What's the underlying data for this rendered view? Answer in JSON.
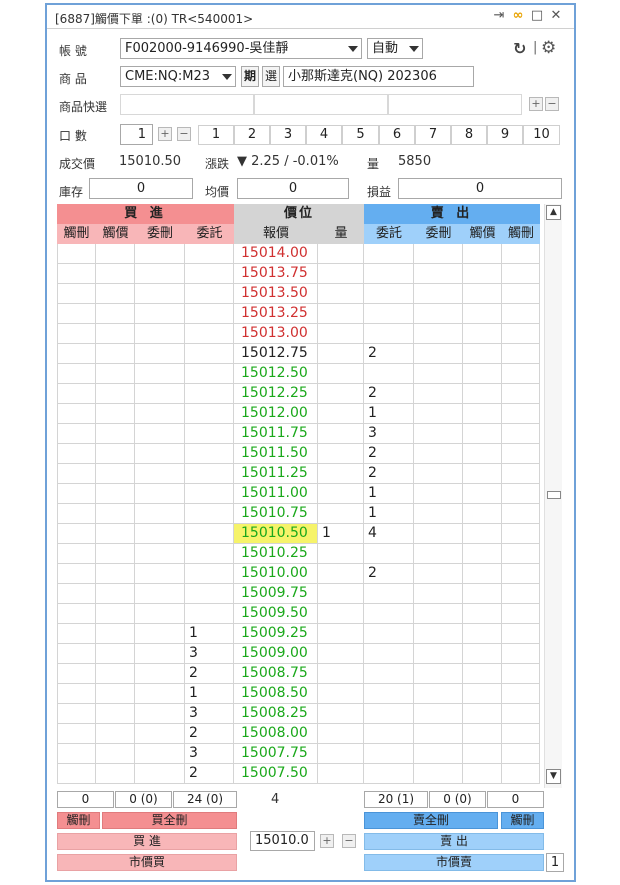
{
  "window": {
    "title": "[6887]觸價下單 :(0) TR<540001>",
    "title_icons": [
      "exit-icon",
      "link-icon",
      "maximize-icon",
      "close-icon"
    ]
  },
  "account": {
    "label": "帳 號",
    "value": "F002000-9146990-吳佳靜",
    "mode": "自動"
  },
  "product": {
    "label": "商 品",
    "code": "CME:NQ:M23",
    "period_button": "期",
    "select_button": "選",
    "name": "小那斯達克(NQ) 202306"
  },
  "quick_select": {
    "label": "商品快選",
    "slots": [
      "",
      "",
      ""
    ]
  },
  "quantity": {
    "label": "口 數",
    "value": "1",
    "presets": [
      "1",
      "2",
      "3",
      "4",
      "5",
      "6",
      "7",
      "8",
      "9",
      "10"
    ]
  },
  "quote": {
    "last_label": "成交價",
    "last_value": "15010.50",
    "change_label": "漲跌",
    "change_value": "▼ 2.25 / -0.01%",
    "volume_label": "量",
    "volume_value": "5850"
  },
  "position": {
    "inventory_label": "庫存",
    "inventory_value": "0",
    "avg_label": "均價",
    "avg_value": "0",
    "pnl_label": "損益",
    "pnl_value": "0"
  },
  "ladder": {
    "buy_header": "買 進",
    "price_header": "價位",
    "sell_header": "賣 出",
    "subheaders": [
      "觸刪",
      "觸價",
      "委刪",
      "委託",
      "報價",
      "量",
      "委託",
      "委刪",
      "觸價",
      "觸刪"
    ],
    "rows": [
      {
        "price": "15014.00",
        "color": "red",
        "buy": "",
        "vol": "",
        "sell": ""
      },
      {
        "price": "15013.75",
        "color": "red",
        "buy": "",
        "vol": "",
        "sell": ""
      },
      {
        "price": "15013.50",
        "color": "red",
        "buy": "",
        "vol": "",
        "sell": ""
      },
      {
        "price": "15013.25",
        "color": "red",
        "buy": "",
        "vol": "",
        "sell": ""
      },
      {
        "price": "15013.00",
        "color": "red",
        "buy": "",
        "vol": "",
        "sell": ""
      },
      {
        "price": "15012.75",
        "color": "black",
        "buy": "",
        "vol": "",
        "sell": "2"
      },
      {
        "price": "15012.50",
        "color": "green",
        "buy": "",
        "vol": "",
        "sell": ""
      },
      {
        "price": "15012.25",
        "color": "green",
        "buy": "",
        "vol": "",
        "sell": "2"
      },
      {
        "price": "15012.00",
        "color": "green",
        "buy": "",
        "vol": "",
        "sell": "1"
      },
      {
        "price": "15011.75",
        "color": "green",
        "buy": "",
        "vol": "",
        "sell": "3"
      },
      {
        "price": "15011.50",
        "color": "green",
        "buy": "",
        "vol": "",
        "sell": "2"
      },
      {
        "price": "15011.25",
        "color": "green",
        "buy": "",
        "vol": "",
        "sell": "2"
      },
      {
        "price": "15011.00",
        "color": "green",
        "buy": "",
        "vol": "",
        "sell": "1"
      },
      {
        "price": "15010.75",
        "color": "green",
        "buy": "",
        "vol": "",
        "sell": "1"
      },
      {
        "price": "15010.50",
        "color": "green",
        "buy": "",
        "vol": "1",
        "sell": "4",
        "highlight": true
      },
      {
        "price": "15010.25",
        "color": "green",
        "buy": "",
        "vol": "",
        "sell": ""
      },
      {
        "price": "15010.00",
        "color": "green",
        "buy": "",
        "vol": "",
        "sell": "2"
      },
      {
        "price": "15009.75",
        "color": "green",
        "buy": "",
        "vol": "",
        "sell": ""
      },
      {
        "price": "15009.50",
        "color": "green",
        "buy": "",
        "vol": "",
        "sell": ""
      },
      {
        "price": "15009.25",
        "color": "green",
        "buy": "1",
        "vol": "",
        "sell": ""
      },
      {
        "price": "15009.00",
        "color": "green",
        "buy": "3",
        "vol": "",
        "sell": ""
      },
      {
        "price": "15008.75",
        "color": "green",
        "buy": "2",
        "vol": "",
        "sell": ""
      },
      {
        "price": "15008.50",
        "color": "green",
        "buy": "1",
        "vol": "",
        "sell": ""
      },
      {
        "price": "15008.25",
        "color": "green",
        "buy": "3",
        "vol": "",
        "sell": ""
      },
      {
        "price": "15008.00",
        "color": "green",
        "buy": "2",
        "vol": "",
        "sell": ""
      },
      {
        "price": "15007.75",
        "color": "green",
        "buy": "3",
        "vol": "",
        "sell": ""
      },
      {
        "price": "15007.50",
        "color": "green",
        "buy": "2",
        "vol": "",
        "sell": ""
      }
    ]
  },
  "footer": {
    "buy_totals": [
      "0",
      "0 (0)",
      "24 (0)"
    ],
    "center_count": "4",
    "sell_totals": [
      "20 (1)",
      "0 (0)",
      "0"
    ],
    "touch_delete_buy": "觸刪",
    "delete_all_buy": "買全刪",
    "delete_all_sell": "賣全刪",
    "touch_delete_sell": "觸刪",
    "buy": "買 進",
    "price_input": "15010.0",
    "sell": "賣 出",
    "market_buy": "市價買",
    "market_sell": "市價賣",
    "market_qty": "1"
  },
  "colors": {
    "buy_header": "#f48f91",
    "buy_subheader": "#f8b6b8",
    "price_header": "#d4d4d4",
    "sell_header": "#64aef0",
    "sell_subheader": "#9fd0fa",
    "price_up": "#d03030",
    "price_down": "#1aa81a",
    "highlight": "#f6f36a"
  }
}
